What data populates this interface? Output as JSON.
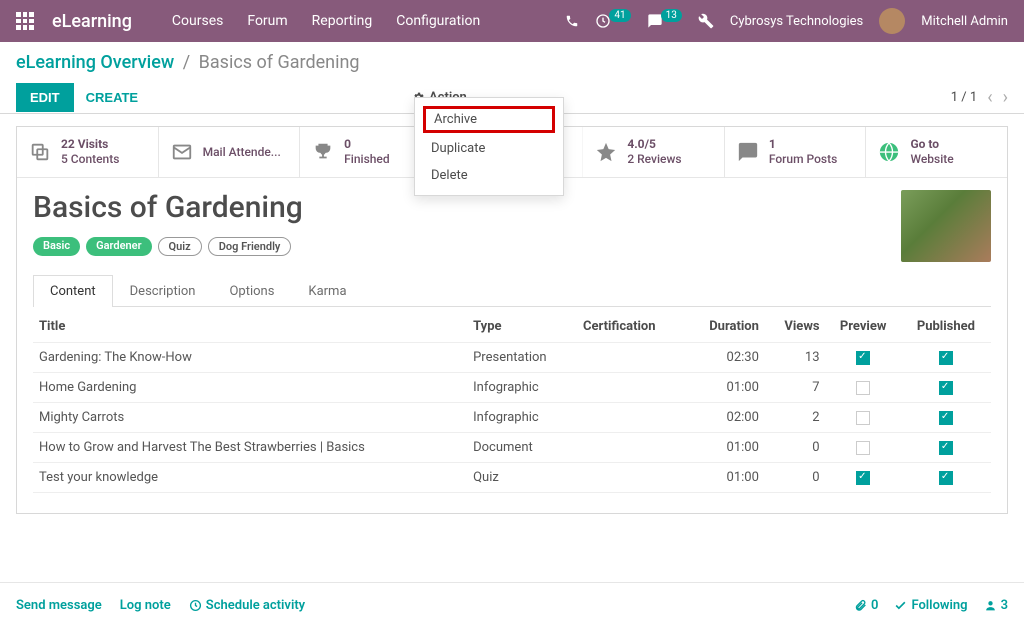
{
  "brand": "eLearning",
  "topnav": {
    "items": [
      "Courses",
      "Forum",
      "Reporting",
      "Configuration"
    ]
  },
  "systray": {
    "activities": "41",
    "messages": "13",
    "company": "Cybrosys Technologies",
    "user": "Mitchell Admin"
  },
  "breadcrumb": {
    "root": "eLearning Overview",
    "current": "Basics of Gardening"
  },
  "buttons": {
    "edit": "EDIT",
    "create": "CREATE"
  },
  "actionmenu": {
    "label": "Action",
    "items": [
      "Archive",
      "Duplicate",
      "Delete"
    ]
  },
  "pager": {
    "text": "1 / 1"
  },
  "stats": {
    "visits": {
      "top": "22 Visits",
      "bottom": "5 Contents"
    },
    "mail": {
      "label": "Mail Attende..."
    },
    "finished": {
      "top": "0",
      "bottom": "Finished"
    },
    "rating": {
      "top": "4.0/5",
      "bottom": "2 Reviews"
    },
    "forum": {
      "top": "1",
      "bottom": "Forum Posts"
    },
    "website": {
      "top": "Go to",
      "bottom": "Website"
    }
  },
  "course": {
    "title": "Basics of Gardening",
    "tags": [
      "Basic",
      "Gardener",
      "Quiz",
      "Dog Friendly"
    ]
  },
  "tabs": [
    "Content",
    "Description",
    "Options",
    "Karma"
  ],
  "table": {
    "headers": {
      "title": "Title",
      "type": "Type",
      "cert": "Certification",
      "duration": "Duration",
      "views": "Views",
      "preview": "Preview",
      "published": "Published"
    },
    "rows": [
      {
        "title": "Gardening: The Know-How",
        "type": "Presentation",
        "cert": "",
        "duration": "02:30",
        "views": "13",
        "preview": true,
        "published": true
      },
      {
        "title": "Home Gardening",
        "type": "Infographic",
        "cert": "",
        "duration": "01:00",
        "views": "7",
        "preview": false,
        "published": true
      },
      {
        "title": "Mighty Carrots",
        "type": "Infographic",
        "cert": "",
        "duration": "02:00",
        "views": "2",
        "preview": false,
        "published": true
      },
      {
        "title": "How to Grow and Harvest The Best Strawberries | Basics",
        "type": "Document",
        "cert": "",
        "duration": "01:00",
        "views": "0",
        "preview": false,
        "published": true
      },
      {
        "title": "Test your knowledge",
        "type": "Quiz",
        "cert": "",
        "duration": "01:00",
        "views": "0",
        "preview": true,
        "published": true
      }
    ]
  },
  "chatter": {
    "send": "Send message",
    "log": "Log note",
    "schedule": "Schedule activity",
    "attachments": "0",
    "following": "Following",
    "followers": "3"
  }
}
